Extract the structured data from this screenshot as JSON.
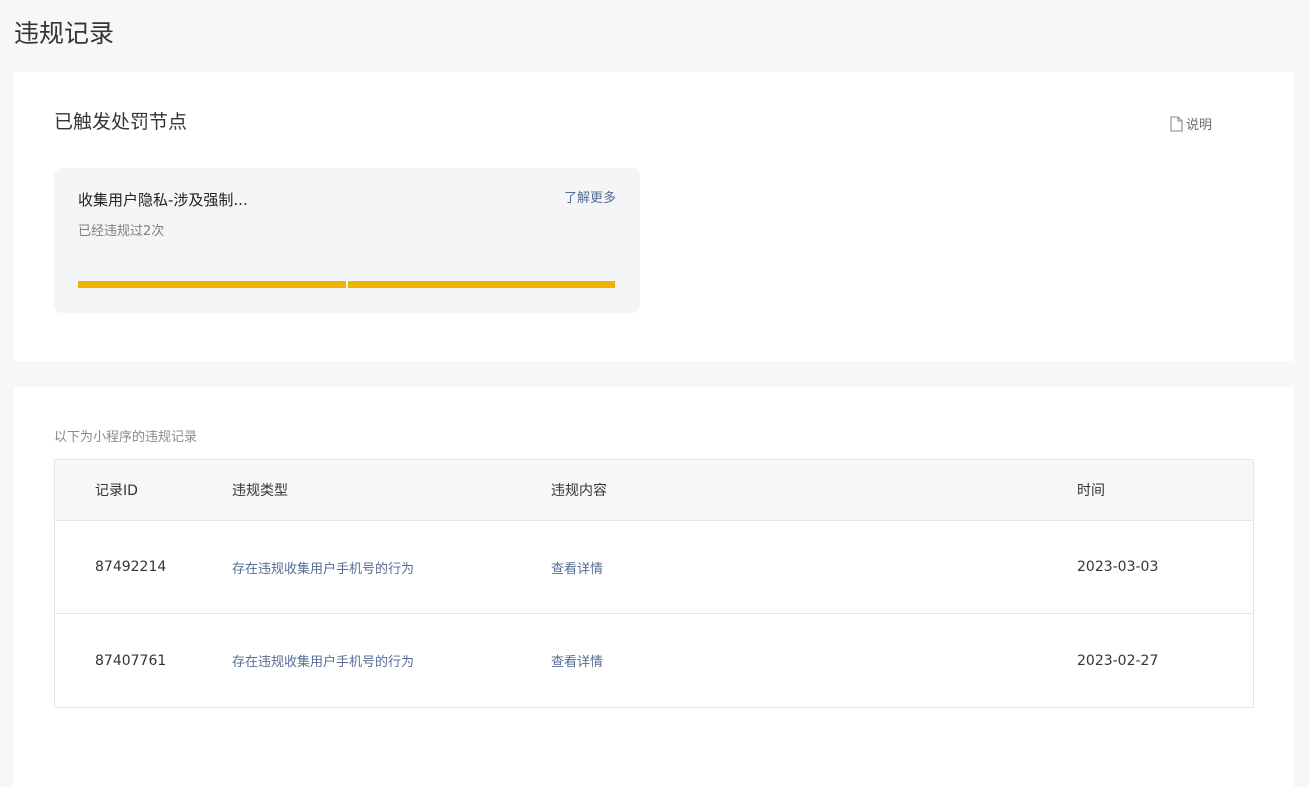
{
  "page": {
    "title": "违规记录"
  },
  "penalty": {
    "section_title": "已触发处罚节点",
    "explain_label": "说明",
    "explain_icon": "document-icon",
    "node": {
      "title": "收集用户隐私-涉及强制...",
      "learn_more": "了解更多",
      "count_text": "已经违规过2次",
      "progress": {
        "filled_segments": 2,
        "total_segments": 2,
        "color": "#f0b400"
      }
    }
  },
  "records": {
    "description": "以下为小程序的违规记录",
    "columns": [
      "记录ID",
      "违规类型",
      "违规内容",
      "时间"
    ],
    "rows": [
      {
        "id": "87492214",
        "type": "存在违规收集用户手机号的行为",
        "content": "查看详情",
        "time": "2023-03-03"
      },
      {
        "id": "87407761",
        "type": "存在违规收集用户手机号的行为",
        "content": "查看详情",
        "time": "2023-02-27"
      }
    ]
  },
  "colors": {
    "link": "#576b95",
    "accent": "#f0b400",
    "background": "#f6f7f9"
  }
}
